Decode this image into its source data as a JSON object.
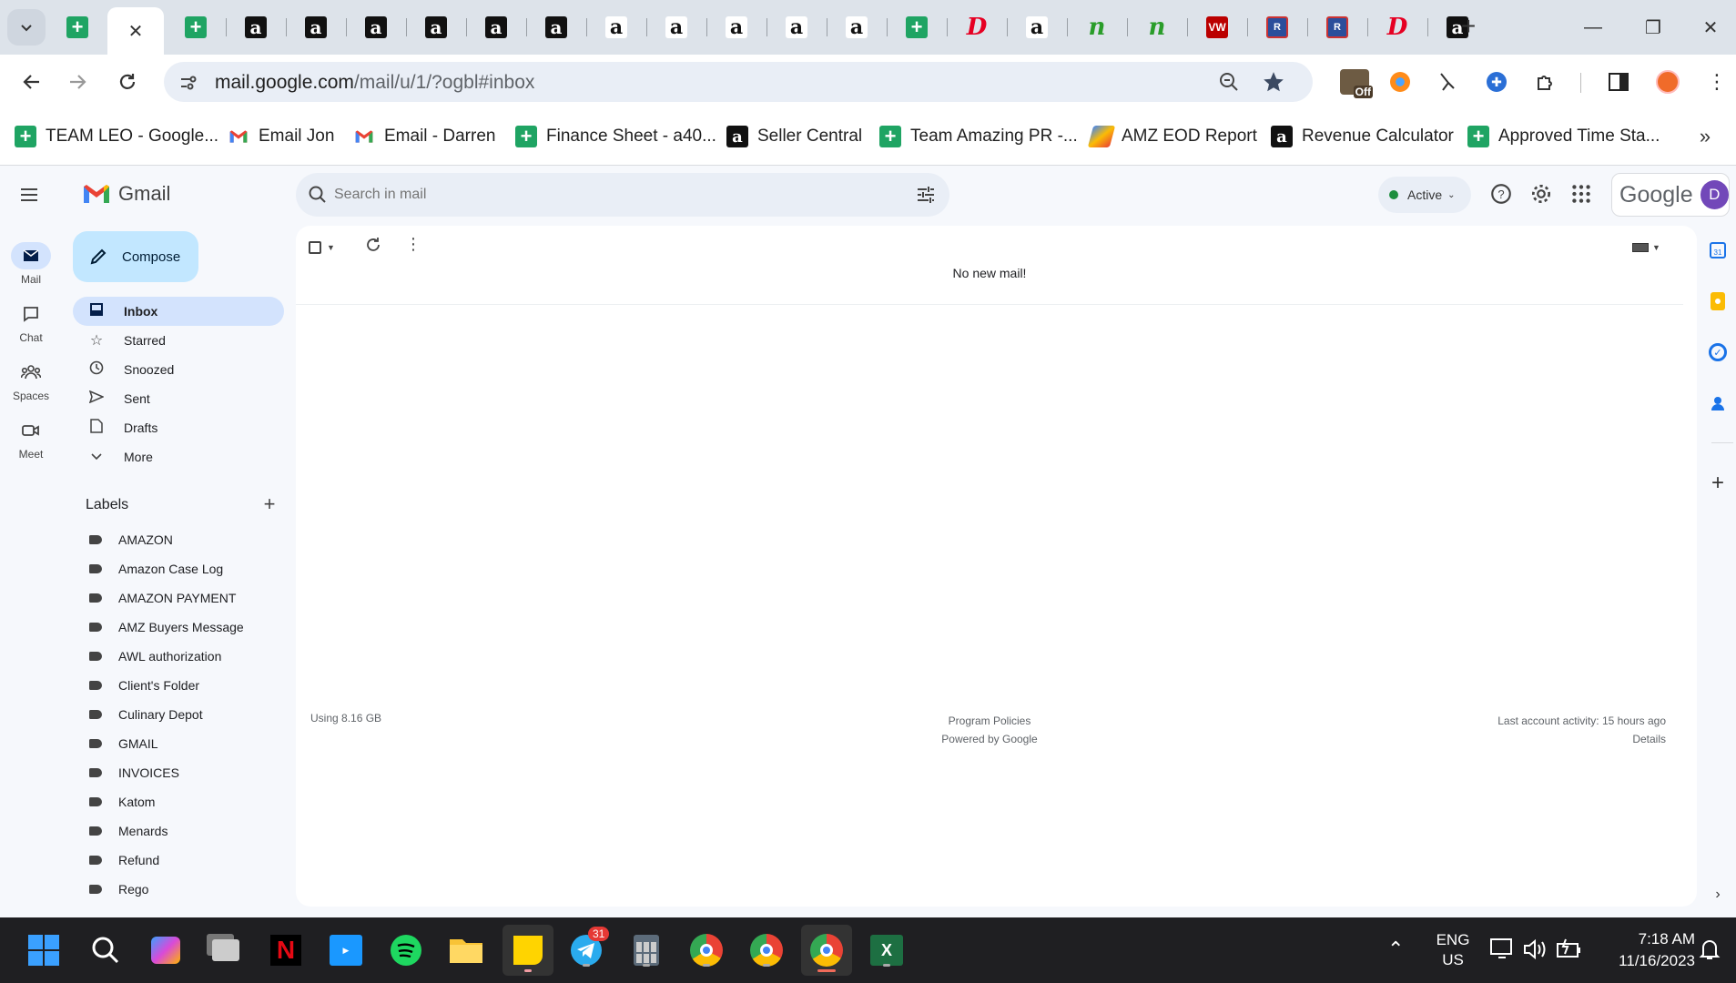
{
  "tab_strip": {
    "tabs": [
      {
        "icon": "sheets",
        "glyph": "+"
      },
      {
        "icon": "close-icon",
        "glyph": "✕",
        "active": true
      },
      {
        "icon": "sheets",
        "glyph": "+"
      },
      {
        "icon": "amazon",
        "glyph": "a"
      },
      {
        "icon": "amazon",
        "glyph": "a"
      },
      {
        "icon": "amazon",
        "glyph": "a"
      },
      {
        "icon": "amazon",
        "glyph": "a"
      },
      {
        "icon": "amazon",
        "glyph": "a"
      },
      {
        "icon": "amazon",
        "glyph": "a"
      },
      {
        "icon": "amazon-white",
        "glyph": "a"
      },
      {
        "icon": "amazon-white",
        "glyph": "a"
      },
      {
        "icon": "amazon-white",
        "glyph": "a"
      },
      {
        "icon": "amazon-white",
        "glyph": "a"
      },
      {
        "icon": "amazon-white",
        "glyph": "a"
      },
      {
        "icon": "sheets",
        "glyph": "+"
      },
      {
        "icon": "pinterest",
        "glyph": "D"
      },
      {
        "icon": "amazon-white",
        "glyph": "a"
      },
      {
        "icon": "nw",
        "glyph": "n"
      },
      {
        "icon": "nw",
        "glyph": "n"
      },
      {
        "icon": "vw",
        "glyph": "VW"
      },
      {
        "icon": "rd",
        "glyph": "R"
      },
      {
        "icon": "rd",
        "glyph": "R"
      },
      {
        "icon": "pinterest",
        "glyph": "D"
      },
      {
        "icon": "amazon",
        "glyph": "a"
      }
    ],
    "new_tab_glyph": "+",
    "minimize": "—",
    "restore": "❐",
    "close": "✕"
  },
  "toolbar": {
    "url_host": "mail.google.com",
    "url_path": "/mail/u/1/?ogbl#inbox",
    "ext_off_label": "Off"
  },
  "bookmarks": [
    {
      "label": "TEAM LEO - Google...",
      "icon": "sheets"
    },
    {
      "label": "Email Jon",
      "icon": "gmail"
    },
    {
      "label": "Email - Darren",
      "icon": "gmail"
    },
    {
      "label": "Finance Sheet - a40...",
      "icon": "sheets"
    },
    {
      "label": "Seller Central",
      "icon": "amazon"
    },
    {
      "label": "Team Amazing PR -...",
      "icon": "sheets"
    },
    {
      "label": "AMZ EOD Report",
      "icon": "colorful"
    },
    {
      "label": "Revenue Calculator",
      "icon": "amazon"
    },
    {
      "label": "Approved Time Sta...",
      "icon": "sheets"
    }
  ],
  "gmail": {
    "brand": "Gmail",
    "search_placeholder": "Search in mail",
    "status": "Active",
    "google_label": "Google",
    "avatar_initial": "D",
    "rail": [
      {
        "label": "Mail"
      },
      {
        "label": "Chat"
      },
      {
        "label": "Spaces"
      },
      {
        "label": "Meet"
      }
    ],
    "compose_label": "Compose",
    "nav": [
      {
        "label": "Inbox",
        "active": true
      },
      {
        "label": "Starred"
      },
      {
        "label": "Snoozed"
      },
      {
        "label": "Sent"
      },
      {
        "label": "Drafts"
      },
      {
        "label": "More"
      }
    ],
    "labels_heading": "Labels",
    "labels": [
      "AMAZON",
      "Amazon Case Log",
      "AMAZON PAYMENT",
      "AMZ Buyers Message",
      "AWL authorization",
      "Client's Folder",
      "Culinary Depot",
      "GMAIL",
      "INVOICES",
      "Katom",
      "Menards",
      "Refund",
      "Rego"
    ],
    "empty_message": "No new mail!",
    "footer": {
      "storage": "Using 8.16 GB",
      "policies": "Program Policies",
      "powered": "Powered by Google",
      "last_activity": "Last account activity: 15 hours ago",
      "details": "Details"
    }
  },
  "taskbar": {
    "telegram_badge": "31",
    "lang_top": "ENG",
    "lang_bottom": "US",
    "time": "7:18 AM",
    "date": "11/16/2023"
  },
  "colors": {
    "accent": "#0b57d0",
    "compose_bg": "#c2e7ff",
    "inbox_active": "#d3e3fd",
    "status_green": "#1e8e3e"
  }
}
